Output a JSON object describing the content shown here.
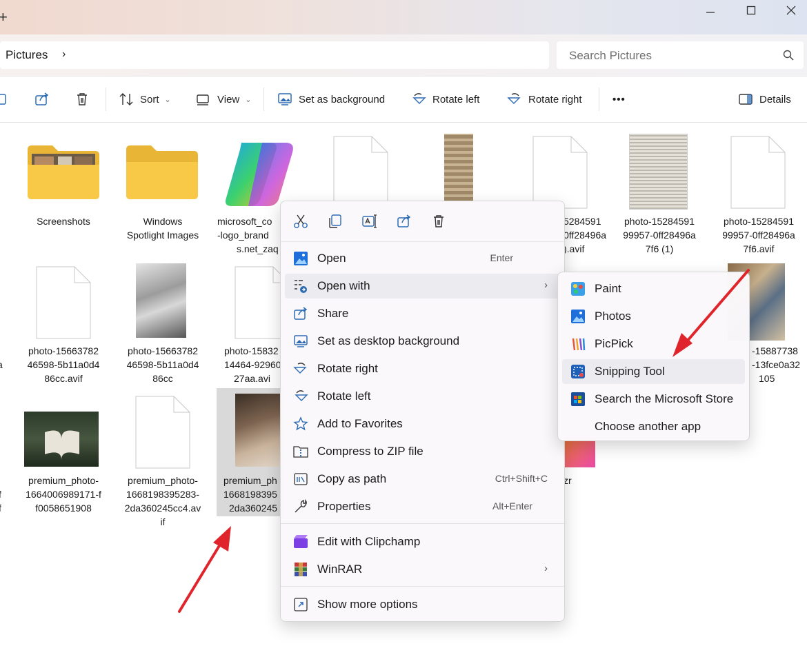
{
  "window": {
    "new_tab": "+",
    "breadcrumb": "Pictures",
    "search_placeholder": "Search Pictures"
  },
  "toolbar": {
    "sort": "Sort",
    "view": "View",
    "set_background": "Set as background",
    "rotate_left": "Rotate left",
    "rotate_right": "Rotate right",
    "more": "•••",
    "details": "Details"
  },
  "files": [
    {
      "name": "Screenshots",
      "lines": [
        "Screenshots"
      ]
    },
    {
      "name": "Windows Spotlight Images",
      "lines": [
        "Windows",
        "Spotlight Images"
      ]
    },
    {
      "name": "microsoft_co...",
      "lines": [
        "microsoft_co",
        "-logo_brand",
        "s.net_zaq"
      ]
    },
    {
      "name": "photo-15284591...a.avif",
      "lines": [
        "5284591",
        "0ff28496a",
        ").avif"
      ]
    },
    {
      "name": "photo-1528459199957-0ff28496a7f6 (1)",
      "lines": [
        "photo-15284591",
        "99957-0ff28496a",
        "7f6 (1)"
      ]
    },
    {
      "name": "photo-1528459199957-0ff28496a7f6.avif",
      "lines": [
        "photo-15284591",
        "99957-0ff28496a",
        "7f6.avif"
      ]
    },
    {
      "name": "a",
      "lines": [
        "a"
      ]
    },
    {
      "name": "photo-1566378246598-5b11a0d486cc.avif",
      "lines": [
        "photo-15663782",
        "46598-5b11a0d4",
        "86cc.avif"
      ]
    },
    {
      "name": "photo-1566378246598-5b11a0d486cc",
      "lines": [
        "photo-15663782",
        "46598-5b11a0d4",
        "86cc"
      ]
    },
    {
      "name": "photo-1583214464-929627aa.avif",
      "lines": [
        "photo-15832",
        "14464-92960",
        "27aa.avi"
      ]
    },
    {
      "name": "photo-15887738...13fce0a32105",
      "lines": [
        "-15887738",
        "-13fce0a32",
        "105"
      ]
    },
    {
      "name": "f",
      "lines": [
        "f",
        "f"
      ]
    },
    {
      "name": "premium_photo-1664006989171-ff0058651908",
      "lines": [
        "premium_photo-",
        "1664006989171-f",
        "f0058651908"
      ]
    },
    {
      "name": "premium_photo-1668198395283-2da360245cc4.avif",
      "lines": [
        "premium_photo-",
        "1668198395283-",
        "2da360245cc4.av",
        "if"
      ]
    },
    {
      "name": "premium_photo-1668198395283-2da360245",
      "lines": [
        "premium_ph",
        "1668198395",
        "2da360245"
      ]
    },
    {
      "name": "zr",
      "lines": [
        "zr"
      ]
    }
  ],
  "context_menu": {
    "quick_actions": [
      "Cut",
      "Copy",
      "Rename",
      "Share",
      "Delete"
    ],
    "items": [
      {
        "label": "Open",
        "shortcut": "Enter"
      },
      {
        "label": "Open with",
        "shortcut": ""
      },
      {
        "label": "Share",
        "shortcut": ""
      },
      {
        "label": "Set as desktop background",
        "shortcut": ""
      },
      {
        "label": "Rotate right",
        "shortcut": ""
      },
      {
        "label": "Rotate left",
        "shortcut": ""
      },
      {
        "label": "Add to Favorites",
        "shortcut": ""
      },
      {
        "label": "Compress to ZIP file",
        "shortcut": ""
      },
      {
        "label": "Copy as path",
        "shortcut": "Ctrl+Shift+C"
      },
      {
        "label": "Properties",
        "shortcut": "Alt+Enter"
      },
      {
        "label": "Edit with Clipchamp",
        "shortcut": ""
      },
      {
        "label": "WinRAR",
        "shortcut": ""
      },
      {
        "label": "Show more options",
        "shortcut": ""
      }
    ]
  },
  "open_with_submenu": {
    "items": [
      "Paint",
      "Photos",
      "PicPick",
      "Snipping Tool",
      "Search the Microsoft Store",
      "Choose another app"
    ],
    "highlighted": "Snipping Tool"
  },
  "colors": {
    "annotation_arrow": "#e0242b",
    "accent": "#0067c0",
    "folder": "#f7c946"
  }
}
